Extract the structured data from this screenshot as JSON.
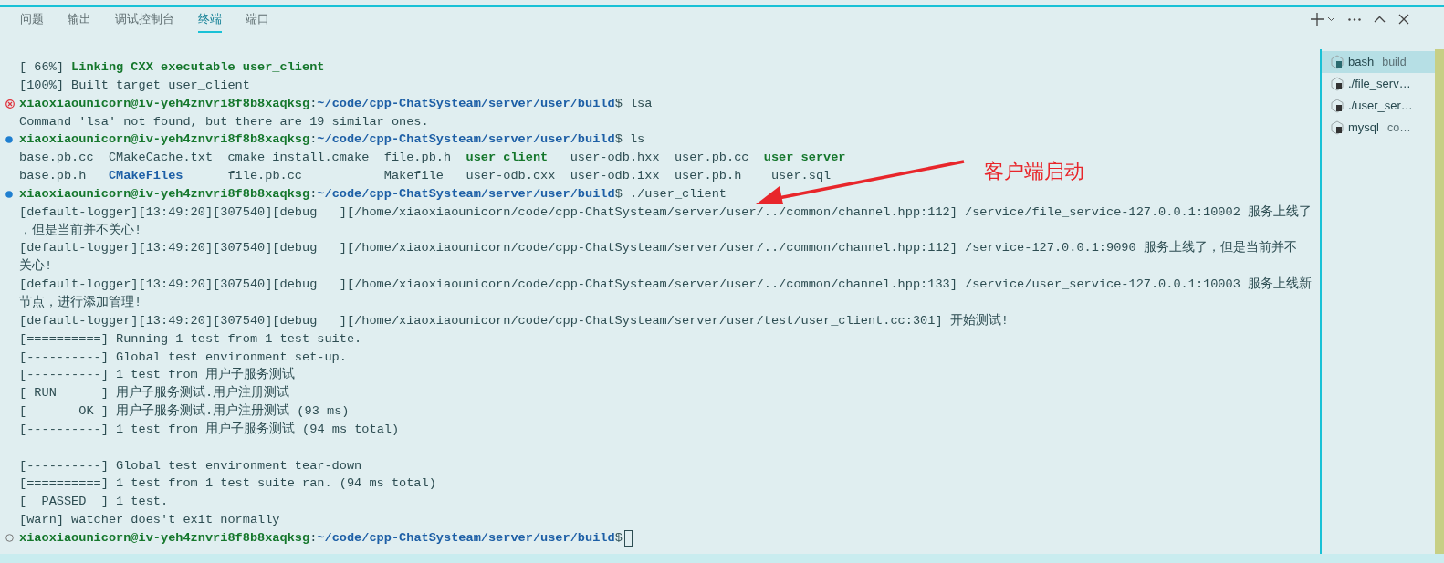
{
  "panel_tabs": [
    {
      "label": "问题",
      "selected": false
    },
    {
      "label": "输出",
      "selected": false
    },
    {
      "label": "调试控制台",
      "selected": false
    },
    {
      "label": "终端",
      "selected": true
    },
    {
      "label": "端口",
      "selected": false
    }
  ],
  "terminal": {
    "lines": [
      {
        "kind": "output",
        "segments": [
          {
            "text": "[ 66%] ",
            "kind": "plain"
          },
          {
            "text": "Linking CXX executable user_client",
            "kind": "emphasis"
          }
        ]
      },
      {
        "kind": "output",
        "segments": [
          {
            "text": "[100%] Built target user_client",
            "kind": "plain"
          }
        ]
      },
      {
        "kind": "prompt",
        "error": true,
        "done": true,
        "segments": [
          {
            "text": "xiaoxiaounicorn@iv-yeh4znvri8f8b8xaqksg",
            "kind": "emphasis"
          },
          {
            "text": ":",
            "kind": "plain"
          },
          {
            "text": "~/code/cpp-ChatSysteam/server/user/build",
            "kind": "directory"
          },
          {
            "text": "$ lsa",
            "kind": "plain"
          }
        ]
      },
      {
        "kind": "output",
        "segments": [
          {
            "text": "Command 'lsa' not found, but there are 19 similar ones.",
            "kind": "plain"
          }
        ]
      },
      {
        "kind": "prompt",
        "error": false,
        "done": true,
        "segments": [
          {
            "text": "xiaoxiaounicorn@iv-yeh4znvri8f8b8xaqksg",
            "kind": "emphasis"
          },
          {
            "text": ":",
            "kind": "plain"
          },
          {
            "text": "~/code/cpp-ChatSysteam/server/user/build",
            "kind": "directory"
          },
          {
            "text": "$ ls",
            "kind": "plain"
          }
        ]
      },
      {
        "kind": "output",
        "segments": [
          {
            "text": "base.pb.cc  CMakeCache.txt  cmake_install.cmake  file.pb.h  ",
            "kind": "plain"
          },
          {
            "text": "user_client",
            "kind": "emphasis"
          },
          {
            "text": "   user-odb.hxx  user.pb.cc  ",
            "kind": "plain"
          },
          {
            "text": "user_server",
            "kind": "emphasis"
          }
        ]
      },
      {
        "kind": "output",
        "segments": [
          {
            "text": "base.pb.h   ",
            "kind": "plain"
          },
          {
            "text": "CMakeFiles",
            "kind": "directory"
          },
          {
            "text": "      file.pb.cc           Makefile   user-odb.cxx  user-odb.ixx  user.pb.h    user.sql",
            "kind": "plain"
          }
        ]
      },
      {
        "kind": "prompt",
        "error": false,
        "done": true,
        "segments": [
          {
            "text": "xiaoxiaounicorn@iv-yeh4znvri8f8b8xaqksg",
            "kind": "emphasis"
          },
          {
            "text": ":",
            "kind": "plain"
          },
          {
            "text": "~/code/cpp-ChatSysteam/server/user/build",
            "kind": "directory"
          },
          {
            "text": "$ ./user_client",
            "kind": "plain"
          }
        ]
      },
      {
        "kind": "output",
        "segments": [
          {
            "text": "[default-logger][13:49:20][307540][debug   ][/home/xiaoxiaounicorn/code/cpp-ChatSysteam/server/user/../common/channel.hpp:112] /service/file_service-127.0.0.1:10002 服务上线了",
            "kind": "plain"
          }
        ]
      },
      {
        "kind": "output",
        "segments": [
          {
            "text": "，但是当前并不关心!",
            "kind": "plain"
          }
        ]
      },
      {
        "kind": "output",
        "segments": [
          {
            "text": "[default-logger][13:49:20][307540][debug   ][/home/xiaoxiaounicorn/code/cpp-ChatSysteam/server/user/../common/channel.hpp:112] /service-127.0.0.1:9090 服务上线了，但是当前并不",
            "kind": "plain"
          }
        ]
      },
      {
        "kind": "output",
        "segments": [
          {
            "text": "关心!",
            "kind": "plain"
          }
        ]
      },
      {
        "kind": "output",
        "segments": [
          {
            "text": "[default-logger][13:49:20][307540][debug   ][/home/xiaoxiaounicorn/code/cpp-ChatSysteam/server/user/../common/channel.hpp:133] /service/user_service-127.0.0.1:10003 服务上线新",
            "kind": "plain"
          }
        ]
      },
      {
        "kind": "output",
        "segments": [
          {
            "text": "节点，进行添加管理!",
            "kind": "plain"
          }
        ]
      },
      {
        "kind": "output",
        "segments": [
          {
            "text": "[default-logger][13:49:20][307540][debug   ][/home/xiaoxiaounicorn/code/cpp-ChatSysteam/server/user/test/user_client.cc:301] 开始测试!",
            "kind": "plain"
          }
        ]
      },
      {
        "kind": "output",
        "segments": [
          {
            "text": "[==========] Running 1 test from 1 test suite.",
            "kind": "plain"
          }
        ]
      },
      {
        "kind": "output",
        "segments": [
          {
            "text": "[----------] Global test environment set-up.",
            "kind": "plain"
          }
        ]
      },
      {
        "kind": "output",
        "segments": [
          {
            "text": "[----------] 1 test from 用户子服务测试",
            "kind": "plain"
          }
        ]
      },
      {
        "kind": "output",
        "segments": [
          {
            "text": "[ RUN      ] 用户子服务测试.用户注册测试",
            "kind": "plain"
          }
        ]
      },
      {
        "kind": "output",
        "segments": [
          {
            "text": "[       OK ] 用户子服务测试.用户注册测试 (93 ms)",
            "kind": "plain"
          }
        ]
      },
      {
        "kind": "output",
        "segments": [
          {
            "text": "[----------] 1 test from 用户子服务测试 (94 ms total)",
            "kind": "plain"
          }
        ]
      },
      {
        "kind": "blank"
      },
      {
        "kind": "output",
        "segments": [
          {
            "text": "[----------] Global test environment tear-down",
            "kind": "plain"
          }
        ]
      },
      {
        "kind": "output",
        "segments": [
          {
            "text": "[==========] 1 test from 1 test suite ran. (94 ms total)",
            "kind": "plain"
          }
        ]
      },
      {
        "kind": "output",
        "segments": [
          {
            "text": "[  PASSED  ] 1 test.",
            "kind": "plain"
          }
        ]
      },
      {
        "kind": "output",
        "segments": [
          {
            "text": "[warn] watcher does't exit normally",
            "kind": "plain"
          }
        ]
      },
      {
        "kind": "prompt",
        "error": false,
        "done": false,
        "cursor": true,
        "segments": [
          {
            "text": "xiaoxiaounicorn@iv-yeh4znvri8f8b8xaqksg",
            "kind": "emphasis"
          },
          {
            "text": ":",
            "kind": "plain"
          },
          {
            "text": "~/code/cpp-ChatSysteam/server/user/build",
            "kind": "directory"
          },
          {
            "text": "$",
            "kind": "plain"
          }
        ]
      }
    ]
  },
  "terminal_list": [
    {
      "name": "bash",
      "detail": "build",
      "selected": true
    },
    {
      "name": "./file_serv…",
      "selected": false
    },
    {
      "name": "./user_ser…",
      "selected": false
    },
    {
      "name": "mysql",
      "detail": "co…",
      "selected": false
    }
  ],
  "annotation": {
    "text": "客户端启动"
  }
}
